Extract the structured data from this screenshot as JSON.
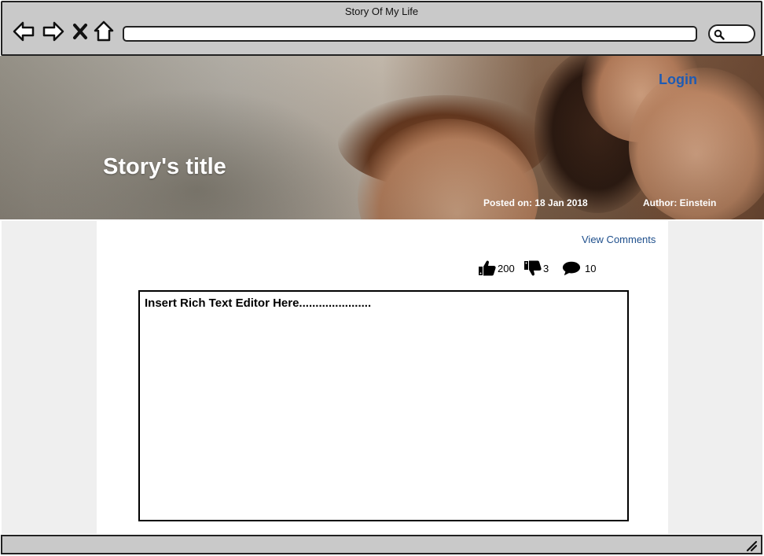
{
  "window": {
    "title": "Story Of My Life"
  },
  "toolbar": {
    "back_icon": "back-arrow-icon",
    "forward_icon": "forward-arrow-icon",
    "stop_icon": "close-icon",
    "home_icon": "home-icon",
    "url_value": "",
    "search_icon": "search-icon"
  },
  "hero": {
    "login_label": "Login",
    "title": "Story's title",
    "posted_on": "Posted on: 18 Jan 2018",
    "author": "Author: Einstein"
  },
  "story": {
    "view_comments_label": "View Comments",
    "likes": "200",
    "dislikes": "3",
    "comments": "10",
    "editor_placeholder": "Insert Rich Text Editor Here......................"
  },
  "colors": {
    "chrome": "#c9c9c9",
    "link": "#1e5bb3",
    "side_panel": "#efefef"
  }
}
